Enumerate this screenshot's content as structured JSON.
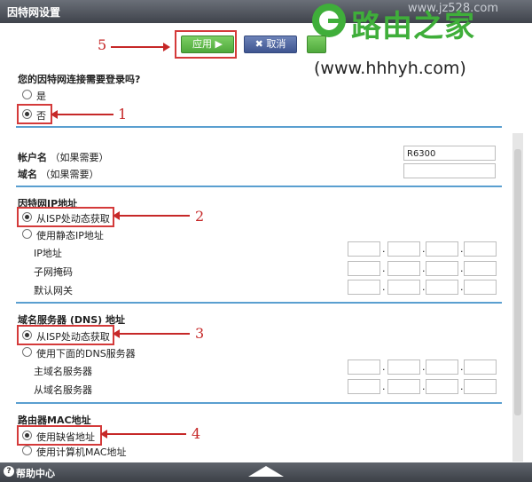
{
  "window": {
    "title": "因特网设置"
  },
  "watermark": {
    "ghost": "www.jz528.com",
    "logo_text": "路由之家",
    "url": "(www.hhhyh.com)"
  },
  "toolbar": {
    "apply_label": "应用 ▶",
    "cancel_label": "✖ 取消"
  },
  "login_question": {
    "label": "您的因特网连接需要登录吗?",
    "options": [
      "是",
      "否"
    ],
    "selected": "否"
  },
  "account": {
    "label": "帐户名",
    "hint": "（如果需要）",
    "value": "R6300"
  },
  "domain": {
    "label": "域名",
    "hint": "（如果需要）",
    "value": ""
  },
  "internet_ip": {
    "title": "因特网IP地址",
    "options": [
      "从ISP处动态获取",
      "使用静态IP地址"
    ],
    "selected": "从ISP处动态获取",
    "fields": [
      "IP地址",
      "子网掩码",
      "默认网关"
    ]
  },
  "dns": {
    "title": "域名服务器 (DNS) 地址",
    "options": [
      "从ISP处动态获取",
      "使用下面的DNS服务器"
    ],
    "selected": "从ISP处动态获取",
    "fields": [
      "主域名服务器",
      "从域名服务器"
    ]
  },
  "mac": {
    "title": "路由器MAC地址",
    "options": [
      "使用缺省地址",
      "使用计算机MAC地址"
    ],
    "selected": "使用缺省地址"
  },
  "annotations": [
    "5",
    "1",
    "2",
    "3",
    "4"
  ],
  "footer": {
    "help": "帮助中心"
  },
  "colors": {
    "accent_green": "#3fae3a",
    "annotation_red": "#c62828",
    "section_line": "#5a9fd0"
  }
}
